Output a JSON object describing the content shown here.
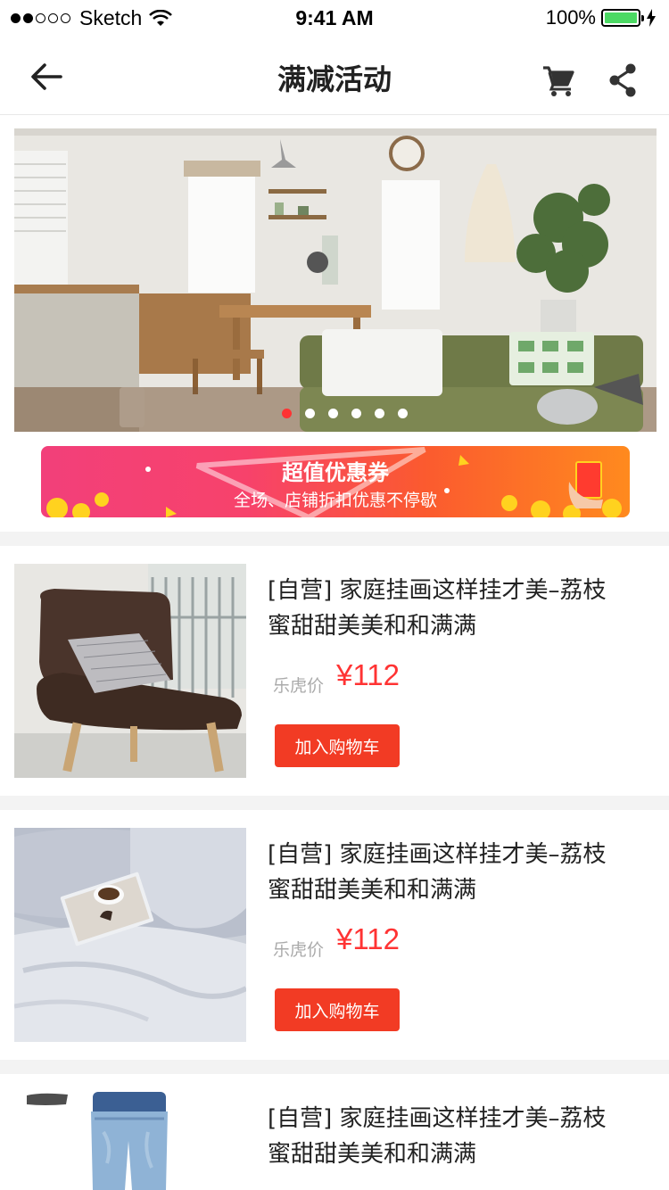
{
  "status_bar": {
    "carrier": "Sketch",
    "time": "9:41 AM",
    "battery": "100%"
  },
  "nav": {
    "title": "满减活动",
    "back_icon": "arrow-left-icon",
    "cart_icon": "cart-icon",
    "share_icon": "share-icon"
  },
  "carousel": {
    "slide_count": 6,
    "active_index": 0
  },
  "coupon": {
    "title": "超值优惠券",
    "subtitle": "全场、店铺折扣优惠不停歇"
  },
  "products": [
    {
      "title_line1": "[自营] 家庭挂画这样挂才美–荔枝",
      "title_line2": "蜜甜甜美美和和满满",
      "price_label": "乐虎价",
      "price": "¥112",
      "button": "加入购物车"
    },
    {
      "title_line1": "[自营] 家庭挂画这样挂才美–荔枝",
      "title_line2": "蜜甜甜美美和和满满",
      "price_label": "乐虎价",
      "price": "¥112",
      "button": "加入购物车"
    },
    {
      "title_line1": "[自营] 家庭挂画这样挂才美–荔枝",
      "title_line2": "蜜甜甜美美和和满满"
    }
  ],
  "colors": {
    "accent": "#f23b24",
    "price": "#ff3333",
    "battery": "#4cd964"
  }
}
